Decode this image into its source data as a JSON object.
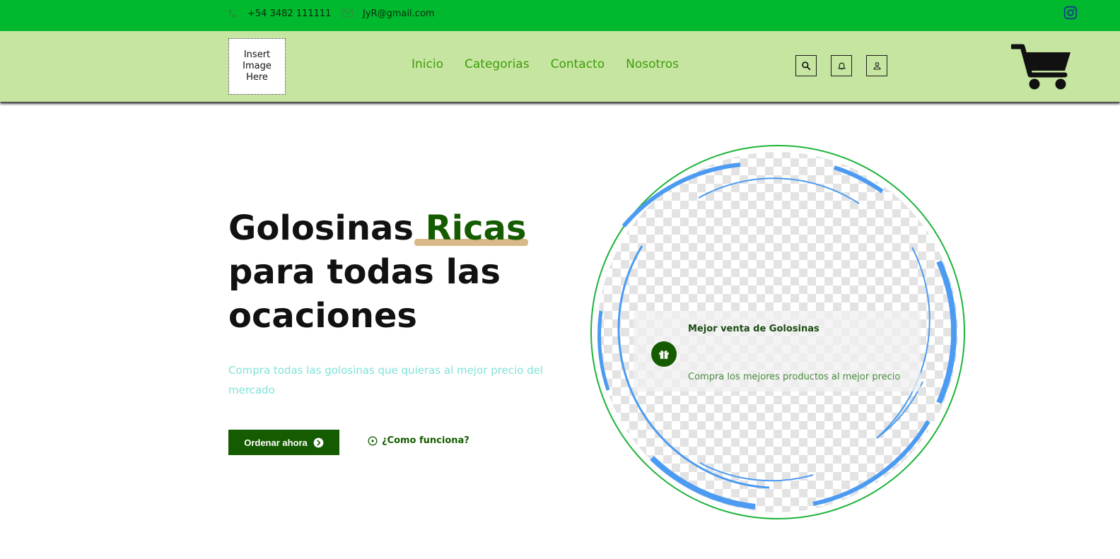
{
  "topbar": {
    "phone": "+54 3482 111111",
    "email": "JyR@gmail.com",
    "icons": {
      "phone": "phone-icon",
      "email": "mail-icon",
      "social": "instagram-icon"
    }
  },
  "header": {
    "logo_text": "Insert\nImage\nHere",
    "nav": [
      "Inicio",
      "Categorias",
      "Contacto",
      "Nosotros"
    ],
    "icons": [
      "search-icon",
      "bell-icon",
      "user-icon",
      "cart-icon"
    ]
  },
  "hero": {
    "title_part1": "Golosinas ",
    "title_accent": "Ricas",
    "title_part2": "para todas las ocaciones",
    "subtitle": "Compra todas las golosinas que quieras al mejor precio del mercado",
    "order_button": "Ordenar ahora",
    "how_link": "¿Como funciona?"
  },
  "feature_card": {
    "title": "Mejor venta de Golosinas",
    "description": "Compra los mejores productos al mejor precio",
    "icon": "gift-icon"
  },
  "colors": {
    "topbar": "#00b92e",
    "header": "#c6e5a0",
    "nav_text": "#3f9c0c",
    "accent_dark": "#155c00",
    "subtitle": "#7fe3d9",
    "arc_blue": "#4b9bf2",
    "ring_green": "#1db33a",
    "highlight": "#d9b98a"
  }
}
